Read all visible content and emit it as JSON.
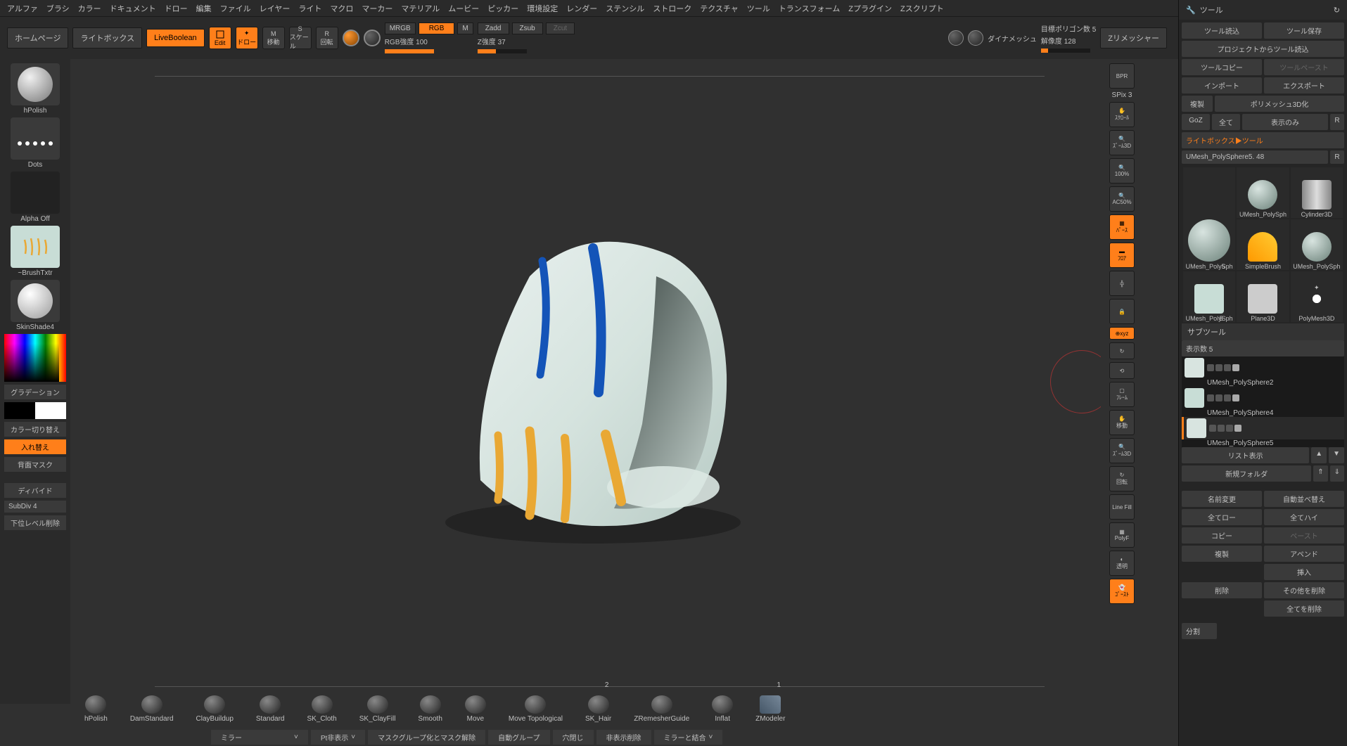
{
  "menu": [
    "アルファ",
    "ブラシ",
    "カラー",
    "ドキュメント",
    "ドロー",
    "編集",
    "ファイル",
    "レイヤー",
    "ライト",
    "マクロ",
    "マーカー",
    "マテリアル",
    "ムービー",
    "ピッカー",
    "環境設定",
    "レンダー",
    "ステンシル",
    "ストローク",
    "テクスチャ",
    "ツール",
    "トランスフォーム",
    "Zプラグイン",
    "Zスクリプト"
  ],
  "toolbar": {
    "homepage": "ホームページ",
    "lightbox": "ライトボックス",
    "liveboolean": "LiveBoolean",
    "edit": "Edit",
    "draw": "ドロー",
    "move": "移動",
    "scale": "スケール",
    "rotate": "回転",
    "mrgb": "MRGB",
    "rgb": "RGB",
    "m": "M",
    "zadd": "Zadd",
    "zsub": "Zsub",
    "zcut": "Zcut",
    "rgb_int_label": "RGB強度 100",
    "z_int_label": "Z強度 37",
    "sculptris": "S",
    "dynamesh_lbl": "ダイナメッシュ",
    "target_lbl": "目標ポリゴン数 5",
    "res_lbl": "解像度 128",
    "zremesher": "Zリメッシャー"
  },
  "left": {
    "brush": "hPolish",
    "stroke": "Dots",
    "alpha": "Alpha Off",
    "texture": "~BrushTxtr",
    "material": "SkinShade4",
    "gradient": "グラデーション",
    "color_switch": "カラー切り替え",
    "swap": "入れ替え",
    "backface": "背面マスク",
    "divide": "ディバイド",
    "subdiv": "SubDiv 4",
    "delete_lower": "下位レベル削除"
  },
  "right_icons": {
    "bpr": "BPR",
    "spix": "SPix 3"
  },
  "right": {
    "tool_title": "ツール",
    "load_tool": "ツール読込",
    "save_tool": "ツール保存",
    "load_project": "プロジェクトからツール読込",
    "copy_tool": "ツールコピー",
    "paste_tool": "ツールペースト",
    "import": "インポート",
    "export": "エクスポート",
    "dup": "複製",
    "make_poly": "ポリメッシュ3D化",
    "goz": "GoZ",
    "all": "全て",
    "visible": "表示のみ",
    "r": "R",
    "lightbox_tools": "ライトボックス▶ツール",
    "mesh_name": "UMesh_PolySphere5. 48",
    "tools": [
      {
        "label": "UMesh_PolySph",
        "badge": "5",
        "kind": "sphere"
      },
      {
        "label": "UMesh_PolySph",
        "kind": "sphere"
      },
      {
        "label": "Cylinder3D",
        "kind": "cyl"
      },
      {
        "label": "SimpleBrush",
        "kind": "simple"
      },
      {
        "label": "UMesh_PolySph",
        "kind": "sphere"
      },
      {
        "label": "UMesh_PolySph",
        "badge": "5",
        "kind": "sphere"
      },
      {
        "label": "Plane3D",
        "kind": "plane"
      },
      {
        "label": "PolyMesh3D",
        "kind": "star"
      }
    ],
    "subtool_header": "サブツール",
    "display_count": "表示数 5",
    "subtools": [
      {
        "label": "UMesh_PolySphere2"
      },
      {
        "label": "UMesh_PolySphere4"
      },
      {
        "label": "UMesh_PolySphere5"
      }
    ],
    "list_view": "リスト表示",
    "new_folder": "新規フォルダ",
    "rename": "名前変更",
    "auto_reorder": "自動並べ替え",
    "all_low": "全てロー",
    "all_high": "全てハイ",
    "copy": "コピー",
    "paste": "ペースト",
    "duplicate": "複製",
    "append": "アペンド",
    "insert": "挿入",
    "delete": "削除",
    "del_other": "その他を削除",
    "del_all": "全てを削除",
    "split": "分割"
  },
  "bottom_brushes": [
    "hPolish",
    "DamStandard",
    "ClayBuildup",
    "Standard",
    "SK_Cloth",
    "SK_ClayFill",
    "Smooth",
    "Move",
    "Move Topological",
    "SK_Hair",
    "ZRemesherGuide",
    "Inflat",
    "ZModeler"
  ],
  "bottom_bar": {
    "mirror": "ミラー",
    "pt_hide": "Pt非表示",
    "mask_grp": "マスクグループ化とマスク解除",
    "auto_grp": "自動グループ",
    "close_hole": "穴閉じ",
    "del_hidden": "非表示削除",
    "mirror_weld": "ミラーと結合"
  }
}
